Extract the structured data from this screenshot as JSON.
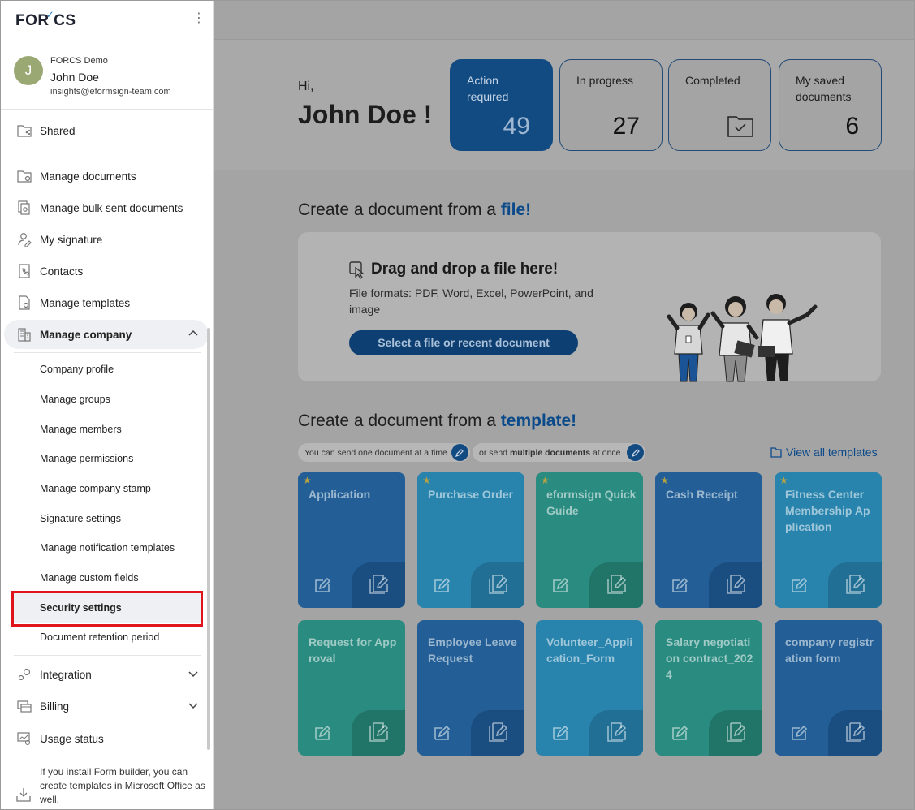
{
  "app": {
    "logo_text": "FORCS",
    "menu_icon": "kebab-menu-icon"
  },
  "user": {
    "avatar_initial": "J",
    "company": "FORCS Demo",
    "name": "John Doe",
    "email": "insights@eformsign-team.com"
  },
  "sidebar": {
    "shared": "Shared",
    "items": [
      {
        "label": "Manage documents",
        "icon": "folder-gear-icon"
      },
      {
        "label": "Manage bulk sent documents",
        "icon": "bulk-documents-icon"
      },
      {
        "label": "My signature",
        "icon": "signature-user-icon"
      },
      {
        "label": "Contacts",
        "icon": "contacts-book-icon"
      },
      {
        "label": "Manage templates",
        "icon": "template-gear-icon"
      }
    ],
    "manage_company": "Manage company",
    "company_sub": [
      "Company profile",
      "Manage groups",
      "Manage members",
      "Manage permissions",
      "Manage company stamp",
      "Signature settings",
      "Manage notification templates",
      "Manage custom fields",
      "Security settings",
      "Document retention period"
    ],
    "integration": "Integration",
    "billing": "Billing",
    "usage_status": "Usage status",
    "footer_text": "If you install Form builder, you can create templates in Microsoft Office as well."
  },
  "header": {
    "greeting": "Hi,",
    "name": "John Doe !",
    "stats": [
      {
        "label": "Action required",
        "value": "49"
      },
      {
        "label": "In progress",
        "value": "27"
      },
      {
        "label": "Completed",
        "value": "",
        "icon": "folder-check-icon"
      },
      {
        "label": "My saved documents",
        "value": "6"
      }
    ]
  },
  "file_section": {
    "title_prefix": "Create a document from a ",
    "title_emph": "file!",
    "drop_title": "Drag and drop a file here!",
    "formats": "File formats: PDF, Word, Excel, PowerPoint, and image",
    "button": "Select a file or recent document"
  },
  "template_section": {
    "title_prefix": "Create a document from a ",
    "title_emph": "template!",
    "pill_one": "You can send one document at a time",
    "pill_multi_prefix": "or send ",
    "pill_multi_bold": "multiple documents",
    "pill_multi_suffix": " at once.",
    "view_all": "View all templates",
    "templates": [
      {
        "name": "Application",
        "starred": true,
        "color": "blue"
      },
      {
        "name": "Purchase Order",
        "starred": true,
        "color": "sky"
      },
      {
        "name": "eformsign Quick Guide",
        "starred": true,
        "color": "teal"
      },
      {
        "name": "Cash Receipt",
        "starred": true,
        "color": "blue"
      },
      {
        "name": "Fitness Center Membership Application",
        "starred": true,
        "color": "sky"
      },
      {
        "name": "Request for Approval",
        "starred": false,
        "color": "teal"
      },
      {
        "name": "Employee Leave Request",
        "starred": false,
        "color": "blue"
      },
      {
        "name": "Volunteer_Application_Form",
        "starred": false,
        "color": "sky"
      },
      {
        "name": "Salary negotiation contract_2024",
        "starred": false,
        "color": "teal"
      },
      {
        "name": "company registration form",
        "starred": false,
        "color": "blue"
      }
    ]
  },
  "colors": {
    "brand_blue": "#124a82",
    "highlight_red": "#e0141b"
  }
}
